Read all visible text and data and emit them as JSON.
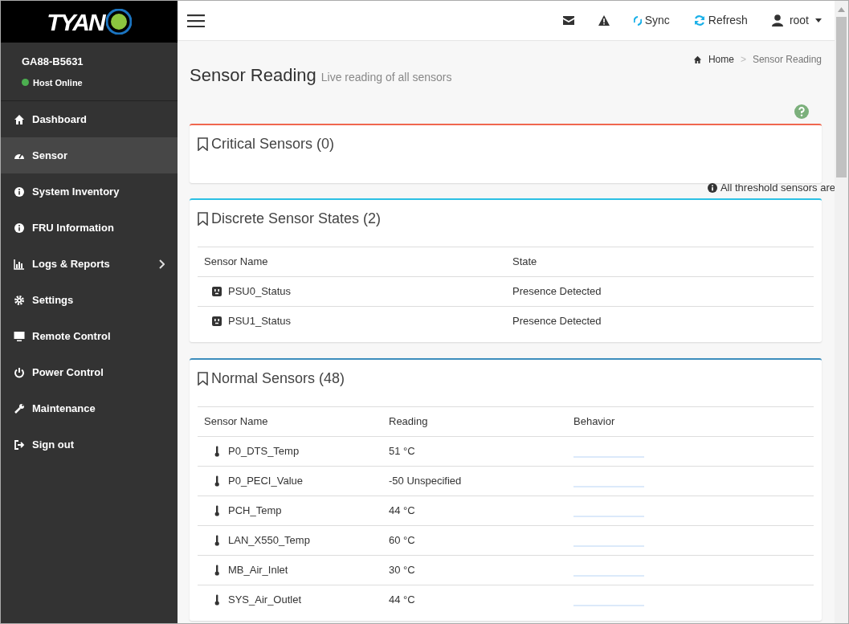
{
  "brand": {
    "logo": "TYAN"
  },
  "host": {
    "name": "GA88-B5631",
    "status": "Host Online",
    "online": true
  },
  "sidebar": {
    "items": [
      {
        "label": "Dashboard",
        "selected": false,
        "submenu": false
      },
      {
        "label": "Sensor",
        "selected": true,
        "submenu": false
      },
      {
        "label": "System Inventory",
        "selected": false,
        "submenu": false
      },
      {
        "label": "FRU Information",
        "selected": false,
        "submenu": false
      },
      {
        "label": "Logs & Reports",
        "selected": false,
        "submenu": true
      },
      {
        "label": "Settings",
        "selected": false,
        "submenu": false
      },
      {
        "label": "Remote Control",
        "selected": false,
        "submenu": false
      },
      {
        "label": "Power Control",
        "selected": false,
        "submenu": false
      },
      {
        "label": "Maintenance",
        "selected": false,
        "submenu": false
      },
      {
        "label": "Sign out",
        "selected": false,
        "submenu": false
      }
    ]
  },
  "topbar": {
    "sync": "Sync",
    "refresh": "Refresh",
    "user": "root"
  },
  "page": {
    "title": "Sensor Reading",
    "subtitle": "Live reading of all sensors",
    "breadcrumb": [
      "Home",
      "Sensor Reading"
    ],
    "separator": ">"
  },
  "threshold_note": "All threshold sensors are",
  "cards": [
    {
      "title": "Critical Sensors (0)",
      "color": "#f0674f"
    },
    {
      "title": "Discrete Sensor States (2)",
      "color": "#2bc0e4",
      "kind": "discrete",
      "columns": [
        "Sensor Name",
        "State"
      ],
      "rows": [
        {
          "name": "PSU0_Status",
          "state": "Presence Detected"
        },
        {
          "name": "PSU1_Status",
          "state": "Presence Detected"
        }
      ]
    },
    {
      "title": "Normal Sensors (48)",
      "color": "#3c8dbc",
      "kind": "normal",
      "columns": [
        "Sensor Name",
        "Reading",
        "Behavior"
      ],
      "rows": [
        {
          "name": "P0_DTS_Temp",
          "reading": "51 °C"
        },
        {
          "name": "P0_PECI_Value",
          "reading": "-50 Unspecified"
        },
        {
          "name": "PCH_Temp",
          "reading": "44 °C"
        },
        {
          "name": "LAN_X550_Temp",
          "reading": "60 °C"
        },
        {
          "name": "MB_Air_Inlet",
          "reading": "30 °C"
        },
        {
          "name": "SYS_Air_Outlet",
          "reading": "44 °C"
        }
      ]
    }
  ]
}
